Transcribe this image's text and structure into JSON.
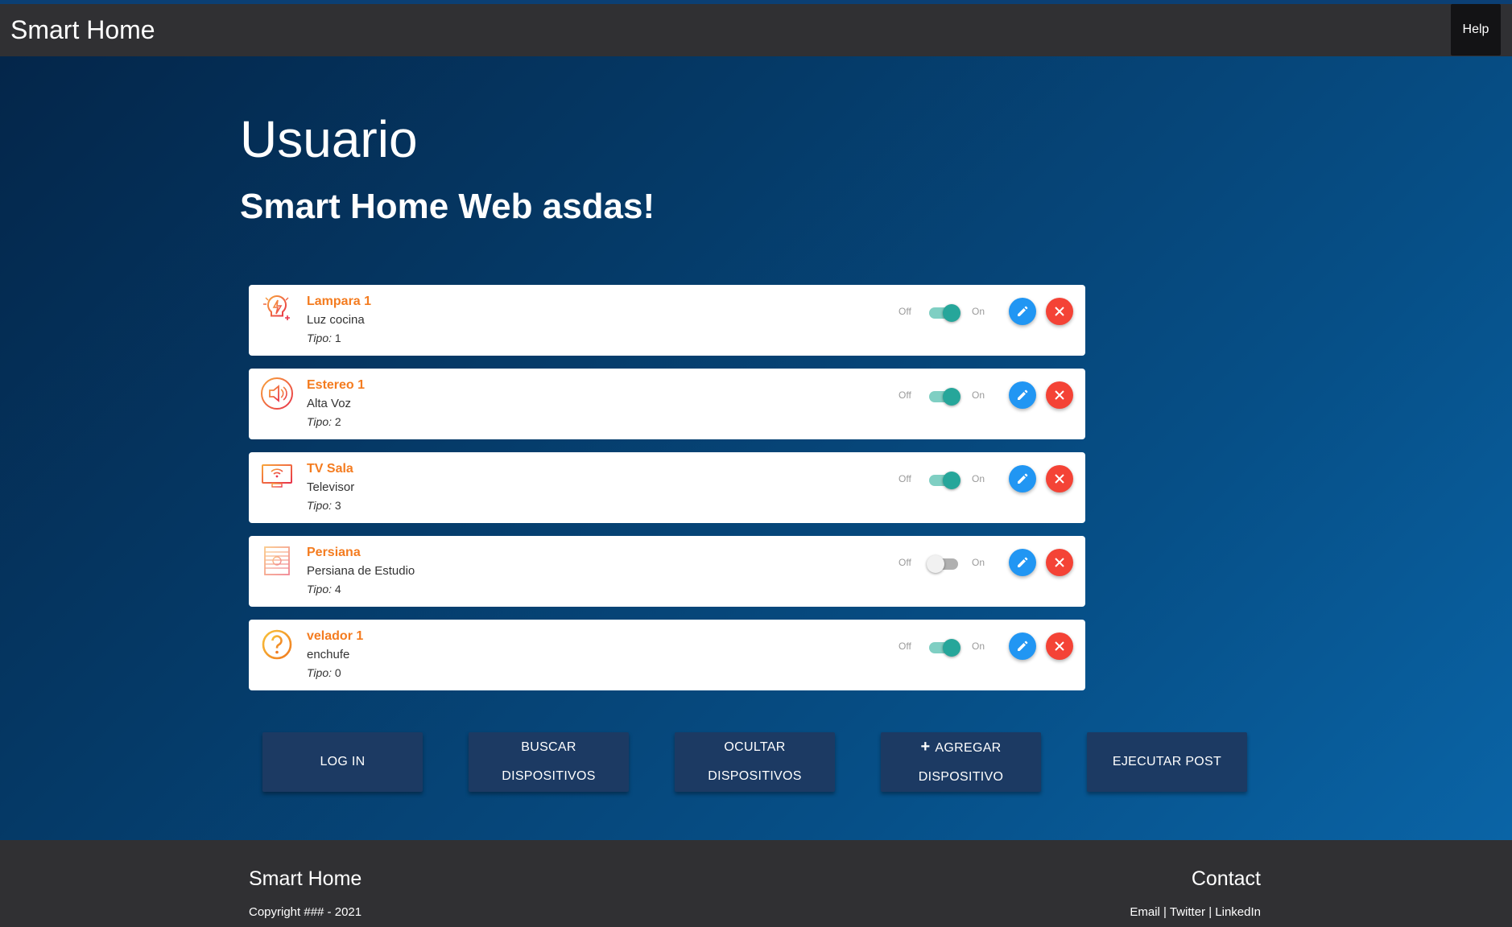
{
  "navbar": {
    "brand": "Smart Home",
    "help_label": "Help"
  },
  "main": {
    "title": "Usuario",
    "subtitle": "Smart Home Web asdas!"
  },
  "labels": {
    "off": "Off",
    "on": "On",
    "type_label": "Tipo:"
  },
  "devices": [
    {
      "name": "Lampara 1",
      "description": "Luz cocina",
      "type": "1",
      "icon": "lightbulb-icon",
      "state": "on"
    },
    {
      "name": "Estereo 1",
      "description": "Alta Voz",
      "type": "2",
      "icon": "speaker-icon",
      "state": "on"
    },
    {
      "name": "TV Sala",
      "description": "Televisor",
      "type": "3",
      "icon": "tv-icon",
      "state": "on"
    },
    {
      "name": "Persiana",
      "description": "Persiana de Estudio",
      "type": "4",
      "icon": "blind-icon",
      "state": "off"
    },
    {
      "name": "velador 1",
      "description": "enchufe",
      "type": "0",
      "icon": "question-icon",
      "state": "on"
    }
  ],
  "actions": {
    "login": "LOG IN",
    "search_line1": "BUSCAR",
    "search_line2": "DISPOSITIVOS",
    "hide_line1": "OCULTAR",
    "hide_line2": "DISPOSITIVOS",
    "add_plus": "+",
    "add_line1": "AGREGAR",
    "add_line2": "DISPOSITIVO",
    "post": "EJECUTAR POST"
  },
  "footer": {
    "brand": "Smart Home",
    "copyright": "Copyright ### - 2021",
    "contact_title": "Contact",
    "link_email": "Email",
    "separator": " | ",
    "link_twitter": "Twitter",
    "link_linkedin": "LinkedIn"
  },
  "colors": {
    "accent_orange": "#f47c20",
    "edit_blue": "#2196f3",
    "delete_red": "#f44336",
    "switch_teal": "#26a69a",
    "navbar": "#303033"
  }
}
